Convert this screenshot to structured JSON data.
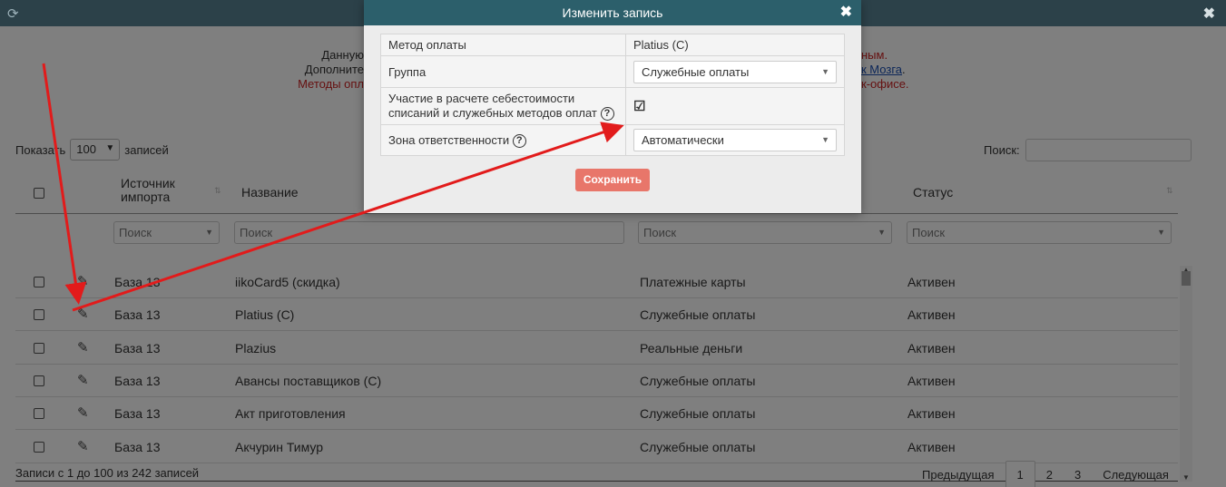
{
  "topbar": {
    "refresh_icon": "refresh-icon",
    "close_icon": "close-icon",
    "close_glyph": "✖"
  },
  "info": {
    "left_line1": "Данную",
    "left_line2": "Дополните",
    "left_line3": "Методы опл",
    "right_line1": "ным.",
    "right_line2": "к Мозга",
    "right_line2_suffix": ".",
    "right_line3": "к-офисе."
  },
  "length_control": {
    "prefix": "Показать",
    "value": "100",
    "suffix": "записей"
  },
  "search": {
    "label": "Поиск:"
  },
  "table": {
    "headers": {
      "source": "Источник импорта",
      "name": "Название",
      "status": "Статус"
    },
    "filter_placeholder": "Поиск",
    "rows": [
      {
        "source": "База 13",
        "name": "iikoCard5 (скидка)",
        "type": "Платежные карты",
        "status": "Активен"
      },
      {
        "source": "База 13",
        "name": "Platius (С)",
        "type": "Служебные оплаты",
        "status": "Активен"
      },
      {
        "source": "База 13",
        "name": "Plazius",
        "type": "Реальные деньги",
        "status": "Активен"
      },
      {
        "source": "База 13",
        "name": "Авансы поставщиков (С)",
        "type": "Служебные оплаты",
        "status": "Активен"
      },
      {
        "source": "База 13",
        "name": "Акт приготовления",
        "type": "Служебные оплаты",
        "status": "Активен"
      },
      {
        "source": "База 13",
        "name": "Акчурин Тимур",
        "type": "Служебные оплаты",
        "status": "Активен"
      }
    ]
  },
  "footer": {
    "info": "Записи с 1 до 100 из 242 записей",
    "prev": "Предыдущая",
    "pages": [
      "1",
      "2",
      "3"
    ],
    "next": "Следующая"
  },
  "modal": {
    "title": "Изменить запись",
    "close_glyph": "✖",
    "fields": {
      "payment_method_label": "Метод оплаты",
      "payment_method_value": "Platius (С)",
      "group_label": "Группа",
      "group_value": "Служебные оплаты",
      "cost_label_line1": "Участие в расчете себестоимости",
      "cost_label_line2": "списаний и служебных методов оплат",
      "cost_checked": true,
      "zone_label": "Зона ответственности",
      "zone_value": "Автоматически"
    },
    "save_label": "Сохранить"
  },
  "colors": {
    "header_bg": "#2c4149",
    "modal_header": "#2c5f6b",
    "save_button": "#e8766a",
    "arrow": "#e21b1b"
  }
}
